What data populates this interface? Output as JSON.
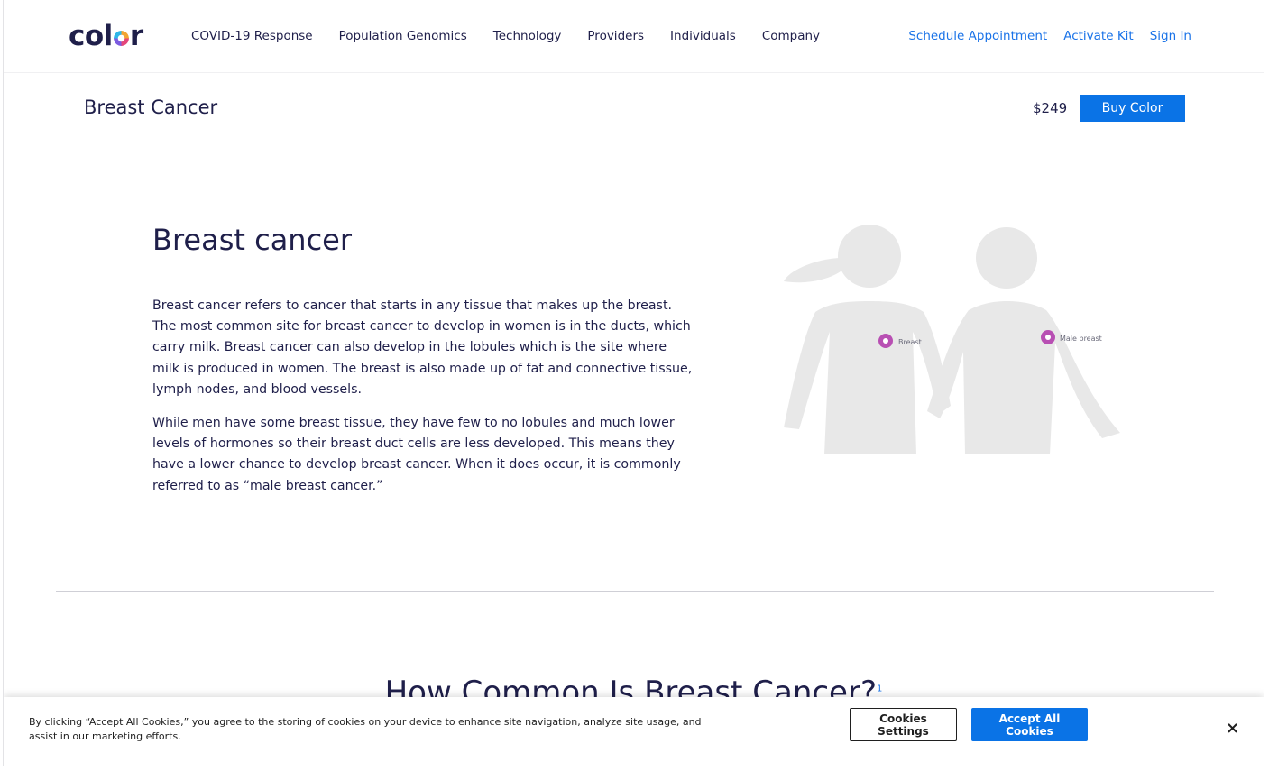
{
  "brand": {
    "logo_text_left": "col",
    "logo_text_right": "r"
  },
  "nav": {
    "links": [
      "COVID-19 Response",
      "Population Genomics",
      "Technology",
      "Providers",
      "Individuals",
      "Company"
    ],
    "right_links": [
      "Schedule Appointment",
      "Activate Kit",
      "Sign In"
    ]
  },
  "subheader": {
    "title": "Breast Cancer",
    "price": "$249",
    "buy_label": "Buy Color"
  },
  "main": {
    "title": "Breast cancer",
    "paragraphs": [
      "Breast cancer refers to cancer that starts in any tissue that makes up the breast. The most common site for breast cancer to develop in women is in the ducts, which carry milk. Breast cancer can also develop in the lobules which is the site where milk is produced in women. The breast is also made up of fat and connective tissue, lymph nodes, and blood vessels.",
      "While men have some breast tissue, they have few to no lobules and much lower levels of hormones so their breast duct cells are less developed. This means they have a lower chance to develop breast cancer. When it does occur, it is commonly referred to as “male breast cancer.”"
    ],
    "illustration": {
      "marker_female": "Breast",
      "marker_male": "Male breast"
    }
  },
  "section": {
    "title": "How Common Is Breast Cancer?",
    "footnote": "1"
  },
  "cookie": {
    "text": "By clicking “Accept All Cookies,” you agree to the storing of cookies on your device to enhance site navigation, analyze site usage, and assist in our marketing efforts.",
    "settings_label": "Cookies Settings",
    "accept_label": "Accept All Cookies",
    "close_label": "×"
  },
  "colors": {
    "accent": "#0a73e6",
    "text": "#1f1f4a",
    "marker": "#b84fb3",
    "silhouette": "#e8e8e8"
  }
}
